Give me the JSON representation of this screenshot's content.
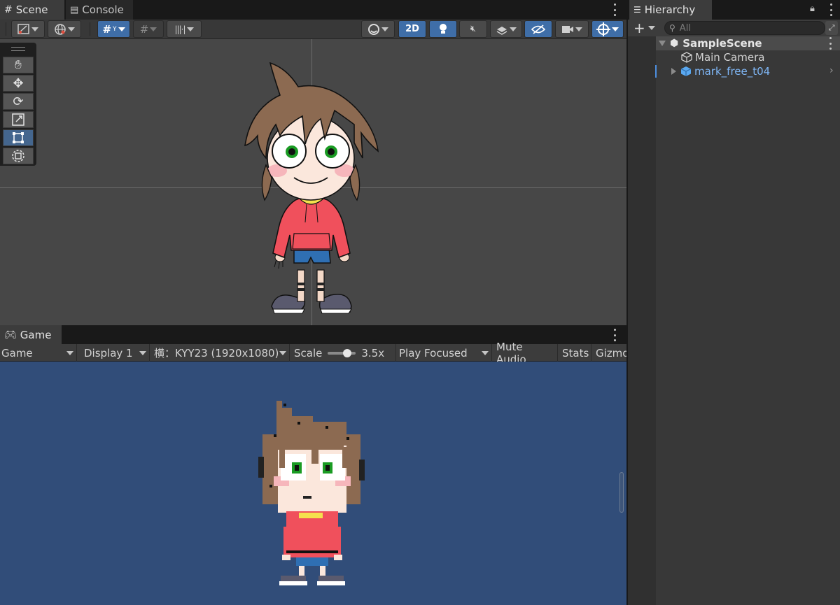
{
  "scene_panel": {
    "tabs": [
      {
        "label": "Scene",
        "icon": "grid-icon"
      },
      {
        "label": "Console",
        "icon": "console-icon"
      }
    ],
    "toolbar": {
      "mode_2d_label": "2D"
    },
    "tools": [
      "hand-tool",
      "move-tool",
      "rotate-tool",
      "scale-tool",
      "rect-tool",
      "transform-tool"
    ],
    "selected_tool": "rect-tool"
  },
  "game_panel": {
    "tab_label": "Game",
    "toolbar": {
      "view_select": "Game",
      "display_select": "Display 1",
      "resolution_select": "横：KYY23 (1920x1080)",
      "scale_label": "Scale",
      "scale_value": "3.5x",
      "scale_fraction": 0.7,
      "play_mode_select": "Play Focused",
      "mute_audio_label": "Mute Audio",
      "stats_label": "Stats",
      "gizmos_label": "Gizmo"
    }
  },
  "hierarchy_panel": {
    "tab_label": "Hierarchy",
    "search_placeholder": "All",
    "scene_name": "SampleScene",
    "items": [
      {
        "label": "Main Camera",
        "icon": "gameobject-cube-icon"
      },
      {
        "label": "mark_free_t04",
        "icon": "prefab-cube-icon"
      }
    ]
  },
  "colors": {
    "scene_background": "#474747",
    "game_background": "#314d79",
    "accent": "#3f6ea8",
    "prefab_text": "#7fb6f5",
    "hoodie": "#f0505c",
    "hair": "#8c6a51",
    "shorts": "#2f6fb3"
  }
}
